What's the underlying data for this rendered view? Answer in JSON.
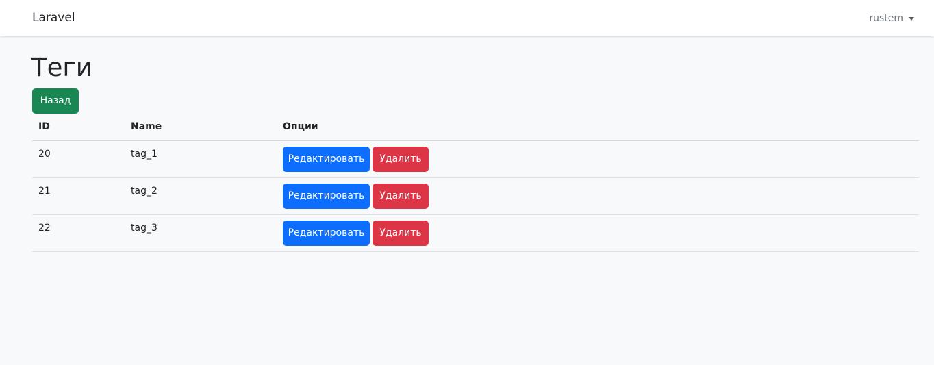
{
  "navbar": {
    "brand": "Laravel",
    "user": "rustem"
  },
  "page": {
    "title": "Теги",
    "back_label": "Назад"
  },
  "table": {
    "headers": [
      "ID",
      "Name",
      "Опции"
    ],
    "rows": [
      {
        "id": "20",
        "name": "tag_1",
        "edit_label": "Редактировать",
        "delete_label": "Удалить"
      },
      {
        "id": "21",
        "name": "tag_2",
        "edit_label": "Редактировать",
        "delete_label": "Удалить"
      },
      {
        "id": "22",
        "name": "tag_3",
        "edit_label": "Редактировать",
        "delete_label": "Удалить"
      }
    ]
  },
  "colors": {
    "background": "#f8f9fa",
    "success": "#198754",
    "primary": "#0d6efd",
    "danger": "#dc3545"
  }
}
